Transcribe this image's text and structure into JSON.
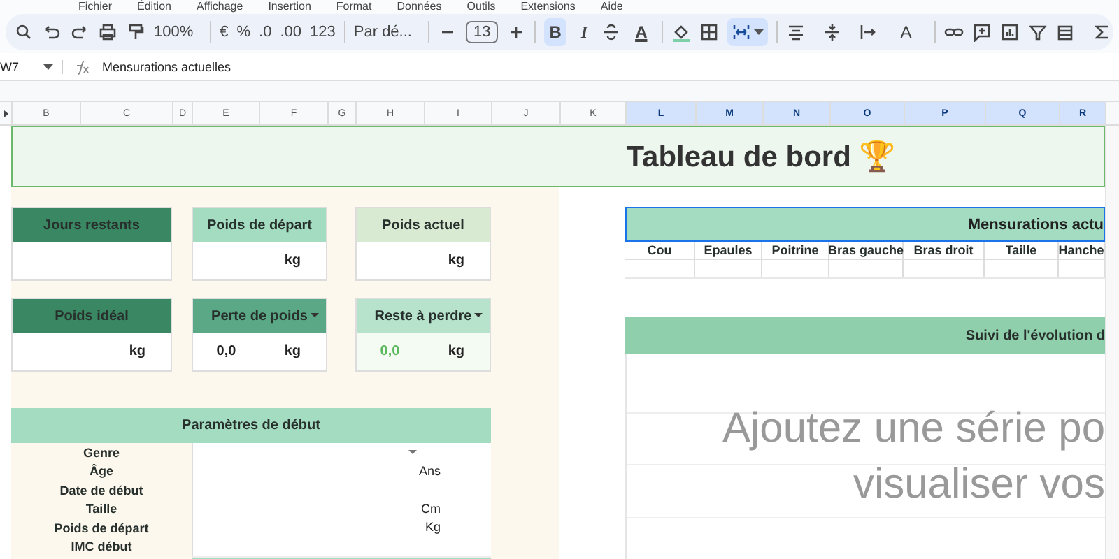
{
  "menu": [
    "Fichier",
    "Édition",
    "Affichage",
    "Insertion",
    "Format",
    "Données",
    "Outils",
    "Extensions",
    "Aide"
  ],
  "toolbar": {
    "zoom": "100%",
    "currency": "€",
    "percent": "%",
    "decrease_decimals": ".0",
    "increase_decimals": ".00",
    "number_format": "123",
    "font": "Par dé...",
    "font_size": "13",
    "bold": {
      "label": "B",
      "selected": true
    },
    "italic": {
      "label": "I",
      "selected": false
    },
    "text_color": "A",
    "merge_selected": true,
    "rotate_label": "A"
  },
  "formula_bar": {
    "cell_ref": "W7",
    "formula": "Mensurations actuelles"
  },
  "columns": [
    {
      "label": "B",
      "selected": false
    },
    {
      "label": "C",
      "selected": false
    },
    {
      "label": "D",
      "selected": false
    },
    {
      "label": "E",
      "selected": false
    },
    {
      "label": "F",
      "selected": false
    },
    {
      "label": "G",
      "selected": false
    },
    {
      "label": "H",
      "selected": false
    },
    {
      "label": "I",
      "selected": false
    },
    {
      "label": "J",
      "selected": false
    },
    {
      "label": "K",
      "selected": false
    },
    {
      "label": "L",
      "selected": true
    },
    {
      "label": "M",
      "selected": true
    },
    {
      "label": "N",
      "selected": true
    },
    {
      "label": "O",
      "selected": true
    },
    {
      "label": "P",
      "selected": true
    },
    {
      "label": "Q",
      "selected": true
    },
    {
      "label": "R",
      "selected": true
    }
  ],
  "title": "Tableau de bord 🏆",
  "cards": [
    {
      "title": "Jours restants",
      "color": "#3a8763",
      "dropdown": false,
      "value_highlighted": false
    },
    {
      "title": "Poids de départ",
      "color": "#a3dcc0",
      "unit": "kg",
      "dropdown": false,
      "value_highlighted": false
    },
    {
      "title": "Poids actuel",
      "color": "#d9ead3",
      "unit": "kg",
      "dropdown": false,
      "value_highlighted": false
    },
    {
      "title": "Poids idéal",
      "color": "#3a8763",
      "unit": "kg",
      "dropdown": false,
      "value_highlighted": false
    },
    {
      "title": "Perte de poids",
      "color": "#5aa885",
      "unit": "kg",
      "value": "0,0",
      "dropdown": true,
      "value_highlighted": false
    },
    {
      "title": "Reste à perdre",
      "color": "#b7e3cd",
      "unit": "kg",
      "value": "0,0",
      "dropdown": true,
      "value_highlighted": true
    }
  ],
  "parameters": {
    "title": "Paramètres de début",
    "rows": [
      {
        "label": "Genre",
        "dropdown": true
      },
      {
        "label": "Âge",
        "unit": "Ans",
        "dropdown": false
      },
      {
        "label": "Date de début",
        "dropdown": false
      },
      {
        "label": "Taille",
        "unit": "Cm",
        "dropdown": false
      },
      {
        "label": "Poids de départ",
        "unit": "Kg",
        "dropdown": false
      },
      {
        "label": "IMC début",
        "dropdown": false
      }
    ]
  },
  "measurements": {
    "title": "Mensurations actu",
    "selected": true,
    "columns": [
      "Cou",
      "Epaules",
      "Poitrine",
      "Bras gauche",
      "Bras droit",
      "Taille",
      "Hanche"
    ]
  },
  "progress": {
    "title": "Suivi de l'évolution d",
    "placeholder_lines": [
      "Ajoutez une série po",
      "visualiser vos"
    ]
  }
}
